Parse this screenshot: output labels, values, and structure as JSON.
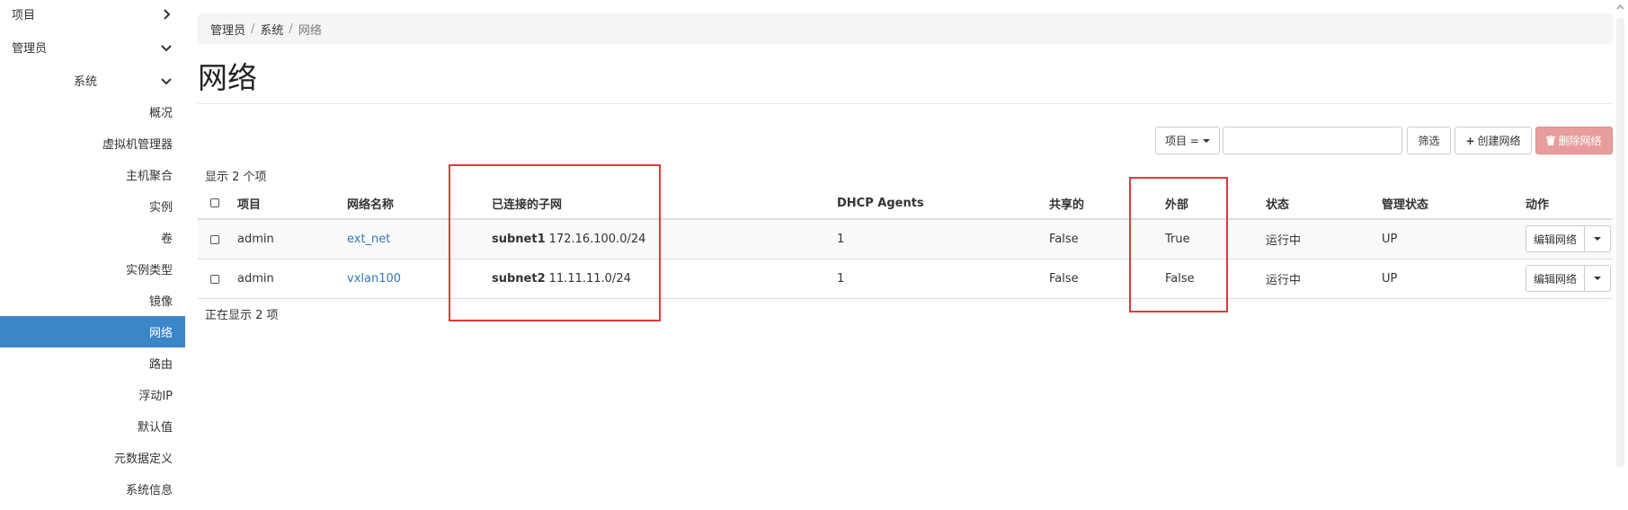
{
  "sidebar": {
    "items": [
      {
        "label": "项目",
        "expanded": false
      },
      {
        "label": "管理员",
        "expanded": true
      },
      {
        "label": "系统",
        "expanded": true
      },
      {
        "label": "概况"
      },
      {
        "label": "虚拟机管理器"
      },
      {
        "label": "主机聚合"
      },
      {
        "label": "实例"
      },
      {
        "label": "卷"
      },
      {
        "label": "实例类型"
      },
      {
        "label": "镜像"
      },
      {
        "label": "网络",
        "active": true
      },
      {
        "label": "路由"
      },
      {
        "label": "浮动IP"
      },
      {
        "label": "默认值"
      },
      {
        "label": "元数据定义"
      },
      {
        "label": "系统信息"
      }
    ]
  },
  "breadcrumb": [
    "管理员",
    "系统",
    "网络"
  ],
  "page": {
    "title": "网络"
  },
  "toolbar": {
    "filter_select": "项目 =",
    "search_value": "",
    "filter_button": "筛选",
    "create_button": "创建网络",
    "delete_button": "删除网络"
  },
  "table": {
    "count_text": "显示 2 个项",
    "footer_text": "正在显示 2 项",
    "headers": {
      "project": "项目",
      "name": "网络名称",
      "subnets": "已连接的子网",
      "dhcp": "DHCP Agents",
      "shared": "共享的",
      "external": "外部",
      "status": "状态",
      "admin_state": "管理状态",
      "actions": "动作"
    },
    "rows": [
      {
        "project": "admin",
        "name": "ext_net",
        "subnet_name": "subnet1",
        "subnet_cidr": "172.16.100.0/24",
        "dhcp": "1",
        "shared": "False",
        "external": "True",
        "status": "运行中",
        "admin_state": "UP",
        "action": "编辑网络"
      },
      {
        "project": "admin",
        "name": "vxlan100",
        "subnet_name": "subnet2",
        "subnet_cidr": "11.11.11.0/24",
        "dhcp": "1",
        "shared": "False",
        "external": "False",
        "status": "运行中",
        "admin_state": "UP",
        "action": "编辑网络"
      }
    ]
  },
  "colors": {
    "active_nav": "#3b86c8",
    "link": "#337ab7",
    "danger_button": "#e89d9c",
    "annotation": "#e0393c"
  }
}
